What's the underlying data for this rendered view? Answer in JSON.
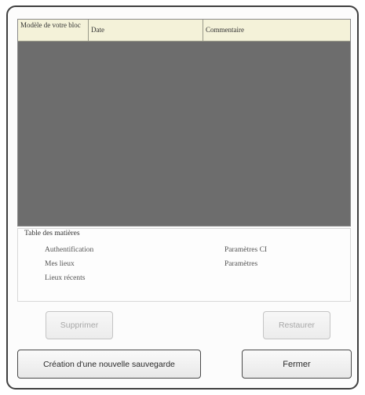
{
  "backups_table": {
    "columns": [
      "Modèle de votre bloc",
      "Date",
      "Commentaire"
    ],
    "rows": []
  },
  "settings_table": {
    "title": "Table des matières",
    "items": [
      "Authentification",
      "Mes lieux",
      "Lieux récents",
      "Paramètres CI",
      "Paramètres"
    ]
  },
  "buttons": {
    "delete": "Supprimer",
    "restore": "Restaurer",
    "create_backup": "Création d'une nouvelle sauvegarde",
    "close": "Fermer"
  }
}
